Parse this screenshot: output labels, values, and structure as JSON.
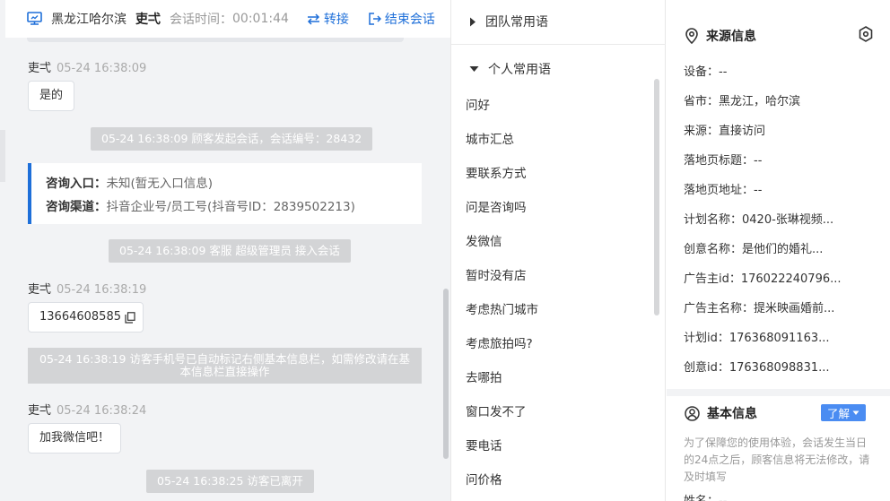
{
  "header": {
    "location": "黑龙江哈尔滨",
    "visitor": "吏弌",
    "time_label": "会话时间：",
    "time": "00:01:44",
    "transfer_label": "转接",
    "end_label": "结束会话"
  },
  "chat": {
    "msg1": {
      "sender": "吏弌",
      "time": "05-24 16:38:09",
      "text": "是的"
    },
    "sys1": "05-24 16:38:09 顾客发起会话，会话编号：28432",
    "entry": {
      "label1": "咨询入口：",
      "value1": "未知(暂无入口信息)",
      "label2": "咨询渠道：",
      "value2": "抖音企业号/员工号(抖音号ID：2839502213)"
    },
    "sys2": "05-24 16:38:09 客服 超级管理员 接入会话",
    "msg2": {
      "sender": "吏弌",
      "time": "05-24 16:38:19",
      "text": "13664608585"
    },
    "sys3_line1": "05-24 16:38:19 访客手机号已自动标记右侧基本信息栏，如需修改请在基",
    "sys3_line2": "本信息栏直接操作",
    "msg3": {
      "sender": "吏弌",
      "time": "05-24 16:38:24",
      "text": "加我微信吧！"
    },
    "sys4": "05-24 16:38:25 访客已离开"
  },
  "phrases": {
    "team_group": "团队常用语",
    "personal_group": "个人常用语",
    "items": [
      "问好",
      "城市汇总",
      "要联系方式",
      "问是咨询吗",
      "发微信",
      "暂时没有店",
      "考虑热门城市",
      "考虑旅拍吗?",
      "去哪拍",
      "窗口发不了",
      "要电话",
      "问价格"
    ]
  },
  "info": {
    "source_title": "来源信息",
    "rows": [
      "设备：--",
      "省市：黑龙江，哈尔滨",
      "来源：直接访问",
      "落地页标题：--",
      "落地页地址：--",
      "计划名称：0420-张琳视频...",
      "创意名称：是他们的婚礼...",
      "广告主id：176022240796...",
      "广告主名称：提米映画婚前...",
      "计划id：176368091163...",
      "创意id：176368098831..."
    ],
    "basic_title": "基本信息",
    "learn_label": "了解",
    "note": "为了保障您的使用体验，会话发生当日的24点之后，顾客信息将无法修改，请及时填写",
    "cut_row": "姓名：--"
  },
  "colors": {
    "accent": "#1e6fd9",
    "system_bubble": "#d3d4d6",
    "chat_bg": "#f2f3f5",
    "learn_button": "#4a8cf2"
  }
}
